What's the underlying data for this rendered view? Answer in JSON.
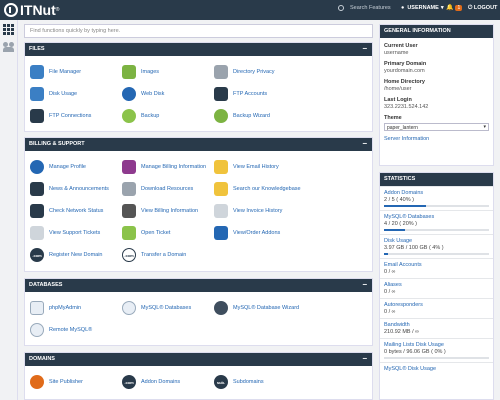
{
  "topbar": {
    "logo_text": "ITNut",
    "logo_tm": "®",
    "search_placeholder": "Search Features",
    "username": "USERNAME",
    "caret": "▾",
    "bell": "🔔",
    "notifications": "1",
    "logout": "LOGOUT"
  },
  "search": {
    "placeholder": "Find functions quickly by typing here."
  },
  "panels": {
    "files": {
      "title": "FILES",
      "collapse": "−",
      "items": [
        "File Manager",
        "Images",
        "Directory Privacy",
        "Disk Usage",
        "Web Disk",
        "FTP Accounts",
        "FTP Connections",
        "Backup",
        "Backup Wizard"
      ]
    },
    "billing": {
      "title": "BILLING & SUPPORT",
      "collapse": "−",
      "items": [
        "Manage Profile",
        "Manage Billing Information",
        "View Email History",
        "News & Announcements",
        "Download Resources",
        "Search our Knowledgebase",
        "Check Network Status",
        "View Billing Information",
        "View Invoice History",
        "View Support Tickets",
        "Open Ticket",
        "View/Order Addons",
        "Register New Domain",
        "Transfer a Domain"
      ]
    },
    "databases": {
      "title": "DATABASES",
      "collapse": "−",
      "items": [
        "phpMyAdmin",
        "MySQL® Databases",
        "MySQL® Database Wizard",
        "Remote MySQL®"
      ]
    },
    "domains": {
      "title": "DOMAINS",
      "collapse": "−",
      "items": [
        "Site Publisher",
        "Addon Domains",
        "Subdomains"
      ]
    }
  },
  "general_info": {
    "title": "GENERAL INFORMATION",
    "current_user_label": "Current User",
    "current_user": "username",
    "primary_domain_label": "Primary Domain",
    "primary_domain": "yourdomain.com",
    "home_dir_label": "Home Directory",
    "home_dir": "/home/user",
    "last_login_label": "Last Login",
    "last_login": "323.2231.524.142",
    "theme_label": "Theme",
    "theme_value": "paper_lantern",
    "server_info": "Server Information"
  },
  "statistics": {
    "title": "STATISTICS",
    "items": [
      {
        "label": "Addon Domains",
        "value": "2 / 5 ( 40% )",
        "pct": 40
      },
      {
        "label": "MySQL® Databases",
        "value": "4 / 20 ( 20% )",
        "pct": 20
      },
      {
        "label": "Disk Usage",
        "value": "3.97 GB / 100 GB ( 4% )",
        "pct": 4
      },
      {
        "label": "Email Accounts",
        "value": "0 / ∞",
        "pct": null
      },
      {
        "label": "Aliases",
        "value": "0 / ∞",
        "pct": null
      },
      {
        "label": "Autoresponders",
        "value": "0 / ∞",
        "pct": null
      },
      {
        "label": "Bandwidth",
        "value": "210.92 MB / ∞",
        "pct": null
      },
      {
        "label": "Mailing Lists Disk Usage",
        "value": "0 bytes / 96.06 GB ( 0% )",
        "pct": 0
      },
      {
        "label": "MySQL® Disk Usage",
        "value": "",
        "pct": null
      }
    ]
  },
  "colors": {
    "header": "#293a4a",
    "link": "#2467b3",
    "badge": "#e06b1a"
  }
}
